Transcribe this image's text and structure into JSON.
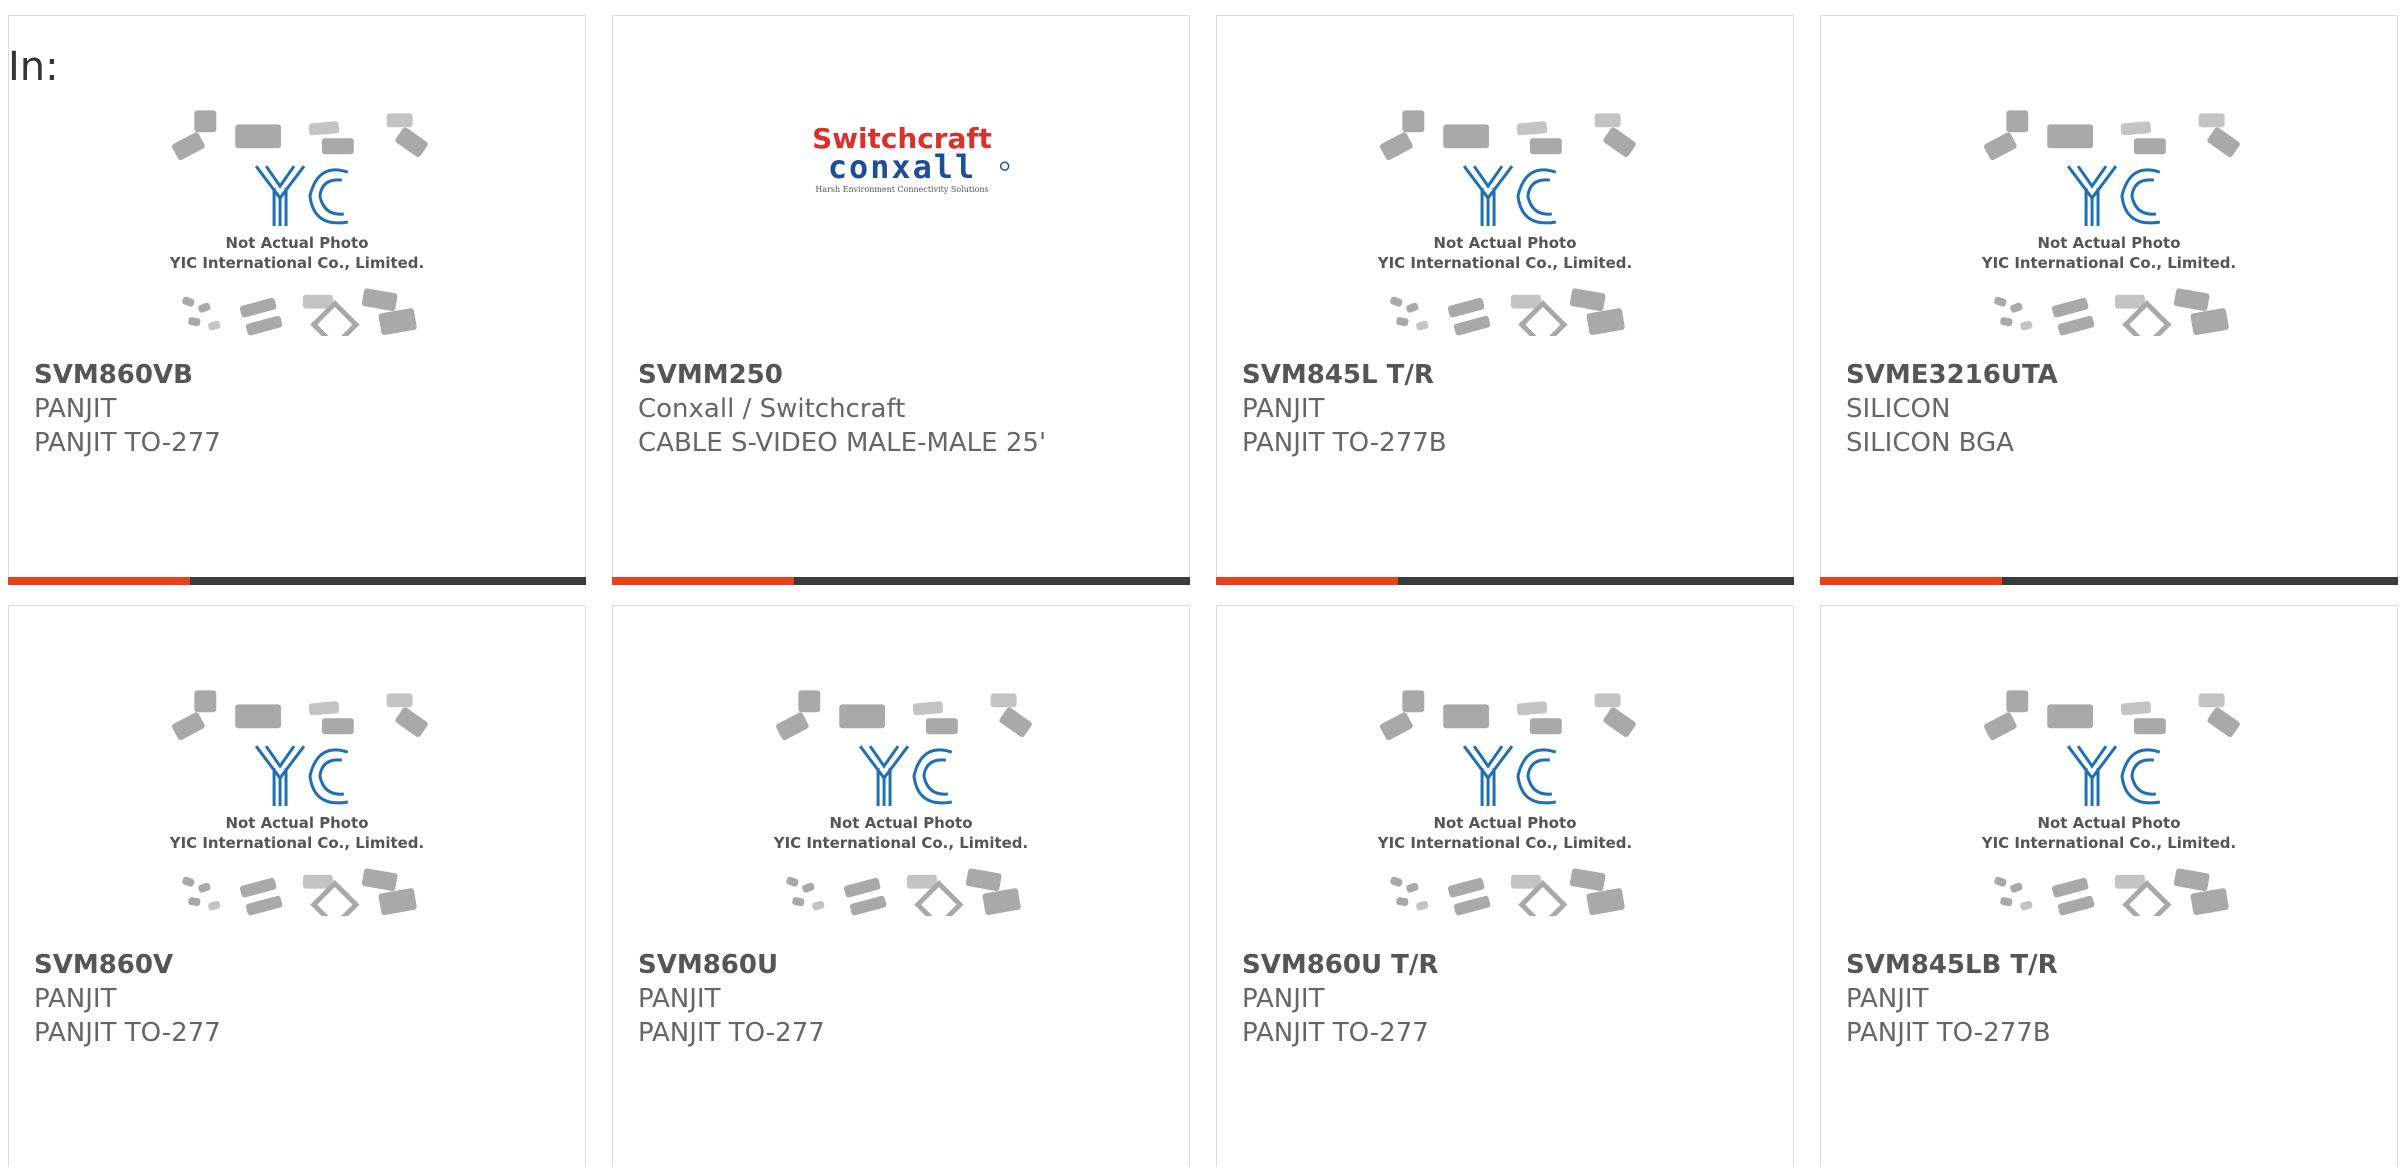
{
  "filter_label": "In:",
  "colors": {
    "accent": "#e8421a",
    "bar": "#3b3b3b",
    "logo_blue": "#1f6fb5",
    "switchcraft_red": "#d8322b",
    "conxall_blue": "#1e4e9a"
  },
  "placeholder": {
    "line1": "Not Actual Photo",
    "line2": "YIC International Co., Limited."
  },
  "switchcraft_logo": {
    "brand_top": "Switchcraft",
    "brand_bottom": "conxall",
    "tagline": "Harsh Environment Connectivity Solutions"
  },
  "products": [
    {
      "part": "SVM860VB",
      "manufacturer": "PANJIT",
      "description": "PANJIT TO-277",
      "image": "yic-placeholder"
    },
    {
      "part": "SVMM250",
      "manufacturer": "Conxall / Switchcraft",
      "description": "CABLE S-VIDEO MALE-MALE 25'",
      "image": "switchcraft-logo"
    },
    {
      "part": "SVM845L T/R",
      "manufacturer": "PANJIT",
      "description": "PANJIT TO-277B",
      "image": "yic-placeholder"
    },
    {
      "part": "SVME3216UTA",
      "manufacturer": "SILICON",
      "description": "SILICON BGA",
      "image": "yic-placeholder"
    },
    {
      "part": "SVM860V",
      "manufacturer": "PANJIT",
      "description": "PANJIT TO-277",
      "image": "yic-placeholder"
    },
    {
      "part": "SVM860U",
      "manufacturer": "PANJIT",
      "description": "PANJIT TO-277",
      "image": "yic-placeholder"
    },
    {
      "part": "SVM860U T/R",
      "manufacturer": "PANJIT",
      "description": "PANJIT TO-277",
      "image": "yic-placeholder"
    },
    {
      "part": "SVM845LB T/R",
      "manufacturer": "PANJIT",
      "description": "PANJIT TO-277B",
      "image": "yic-placeholder"
    }
  ]
}
